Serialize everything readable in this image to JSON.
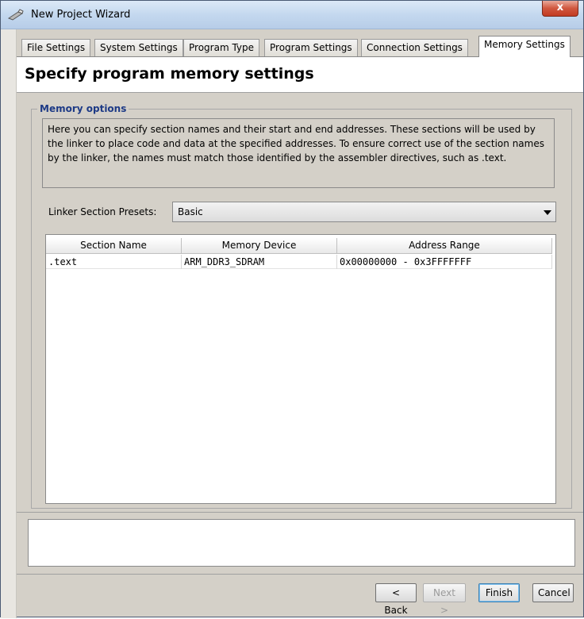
{
  "window": {
    "title": "New Project Wizard",
    "close_label": "x"
  },
  "tabs": [
    {
      "label": "File Settings"
    },
    {
      "label": "System Settings"
    },
    {
      "label": "Program Type"
    },
    {
      "label": "Program Settings"
    },
    {
      "label": "Connection Settings"
    },
    {
      "label": "Memory Settings",
      "active": true
    }
  ],
  "header": {
    "title": "Specify program memory settings"
  },
  "memory_options": {
    "legend": "Memory options",
    "description": "Here you can specify section names and their start and end addresses. These sections will be used by the linker to place code and data at the specified addresses. To ensure correct use of the section names by the linker, the names must match those identified by the assembler directives, such as .text.",
    "preset_label": "Linker Section Presets:",
    "preset_value": "Basic"
  },
  "table": {
    "columns": [
      "Section Name",
      "Memory Device",
      "Address Range"
    ],
    "rows": [
      [
        ".text",
        "ARM_DDR3_SDRAM",
        "0x00000000 - 0x3FFFFFFF"
      ]
    ]
  },
  "buttons": {
    "back": "< Back",
    "next": "Next >",
    "finish": "Finish",
    "cancel": "Cancel"
  },
  "colors": {
    "legend": "#1d3a86",
    "window_bg": "#d4d0c8",
    "close_button": "#c23b22"
  }
}
